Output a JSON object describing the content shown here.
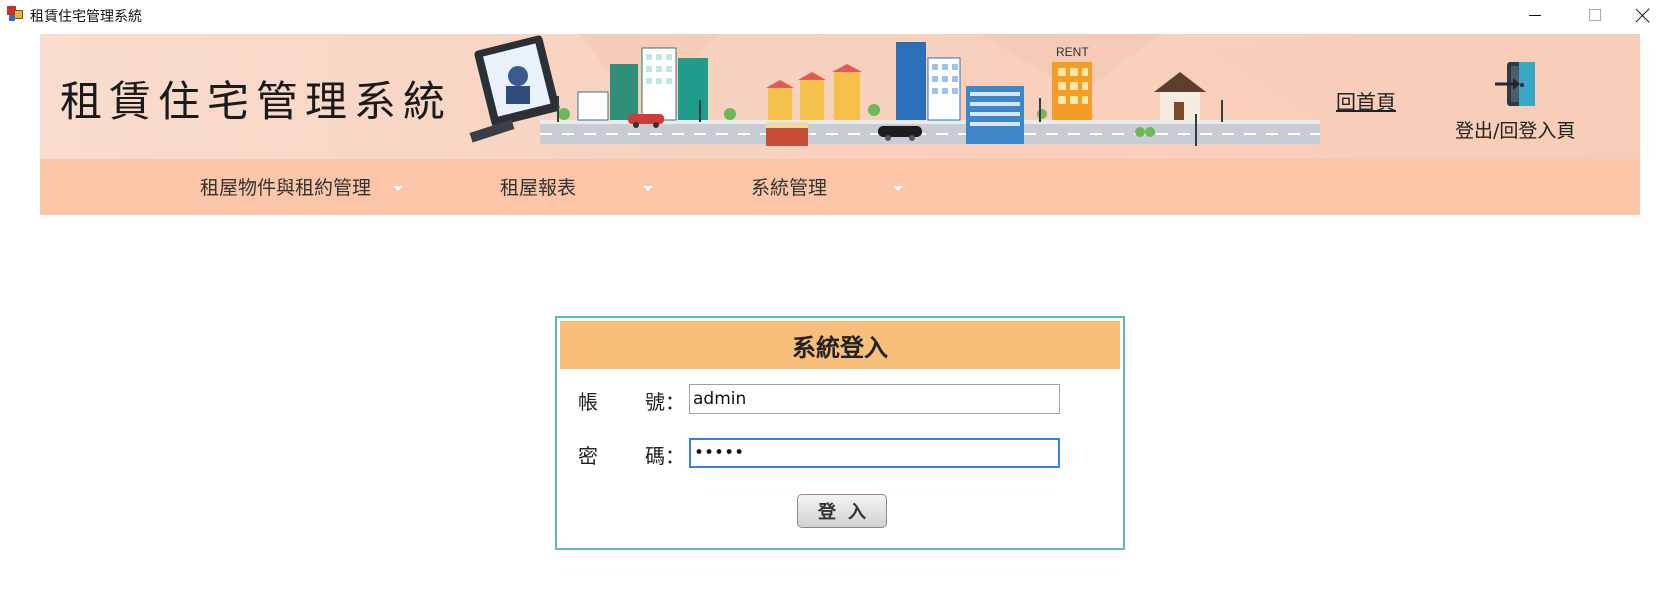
{
  "window": {
    "title": "租賃住宅管理系統",
    "icons": {
      "app": "app-icon",
      "minimize": "minimize-icon",
      "maximize": "maximize-icon",
      "close": "close-icon"
    }
  },
  "banner": {
    "system_title": "租賃住宅管理系統",
    "illustration_sign": "RENT",
    "home_link": "回首頁",
    "logout_label": "登出/回登入頁"
  },
  "menu": {
    "items": [
      {
        "label": "租屋物件與租約管理"
      },
      {
        "label": "租屋報表"
      },
      {
        "label": "系統管理"
      }
    ]
  },
  "login": {
    "header": "系統登入",
    "account_label_1": "帳",
    "account_label_2": "號：",
    "account_value": "admin",
    "password_label_1": "密",
    "password_label_2": "碼：",
    "password_value": "•••••",
    "submit_label": "登入"
  },
  "colors": {
    "banner_bg": "#f8d3c0",
    "menu_bg": "#fbc6a8",
    "login_header_bg": "#f7bf7a",
    "login_border": "#5ab7bb",
    "focus_border": "#3c7fd6"
  }
}
